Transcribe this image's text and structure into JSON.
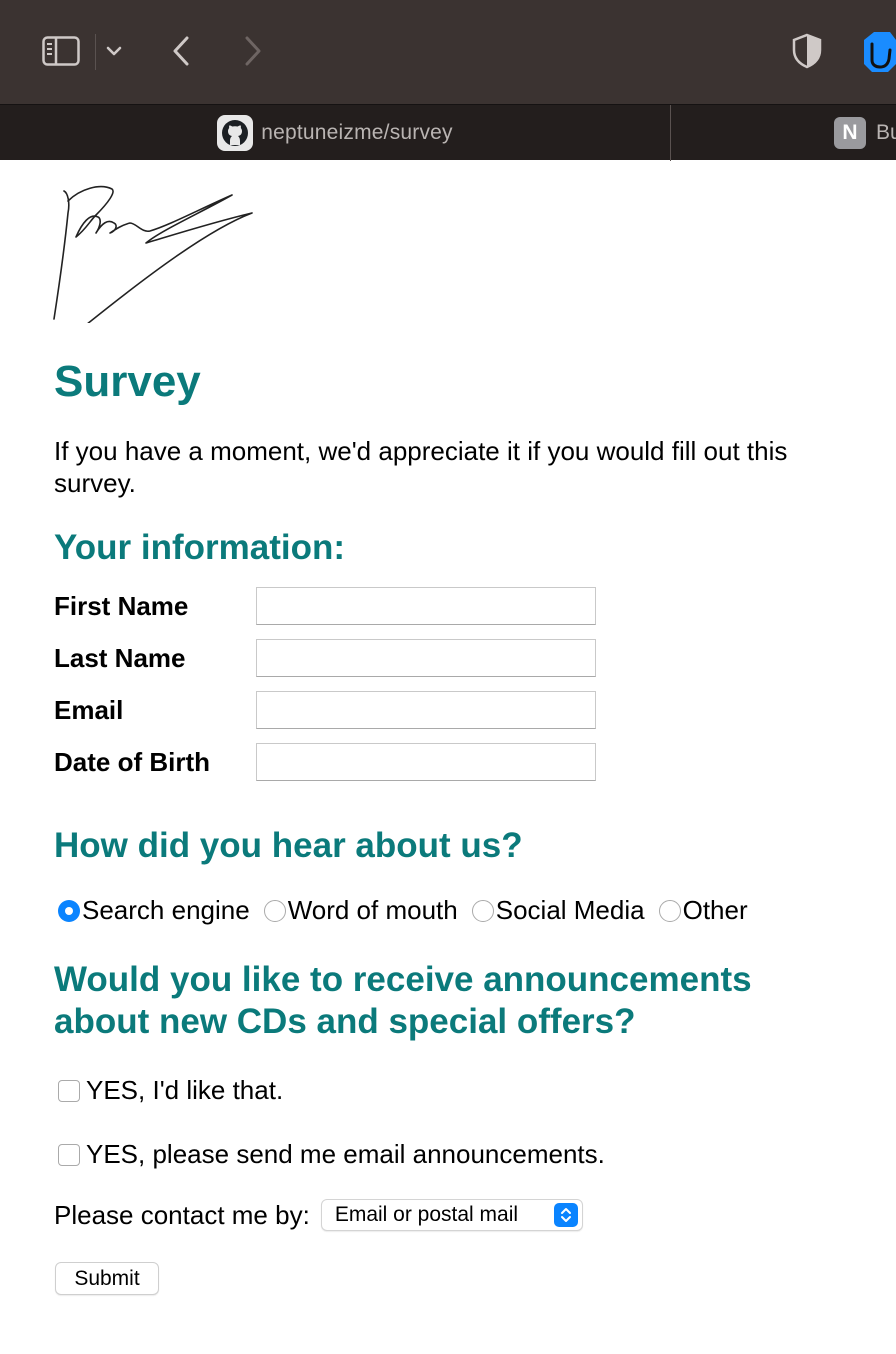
{
  "browser": {
    "active_tab_title": "neptuneizme/survey",
    "second_tab_letter": "N",
    "second_tab_title": "Bu"
  },
  "page": {
    "title": "Survey",
    "intro": "If you have a moment, we'd appreciate it if you would fill out this survey.",
    "info_heading": "Your information:",
    "fields": [
      {
        "label": "First Name",
        "value": ""
      },
      {
        "label": "Last Name",
        "value": ""
      },
      {
        "label": "Email",
        "value": ""
      },
      {
        "label": "Date of Birth",
        "value": ""
      }
    ],
    "hear_heading": "How did you hear about us?",
    "hear_options": [
      {
        "label": "Search engine",
        "checked": true
      },
      {
        "label": "Word of mouth",
        "checked": false
      },
      {
        "label": "Social Media",
        "checked": false
      },
      {
        "label": "Other",
        "checked": false
      }
    ],
    "announce_heading": "Would you like to receive announcements about new CDs and special offers?",
    "checkboxes": [
      {
        "label": "YES, I'd like that.",
        "checked": false
      },
      {
        "label": "YES, please send me email announcements.",
        "checked": false
      }
    ],
    "contact_label": "Please contact me by:",
    "contact_selected": "Email or postal mail",
    "submit_label": "Submit"
  },
  "colors": {
    "heading": "#0b7a7b",
    "toolbar": "#3b3331",
    "tabbar": "#231e1d",
    "accent": "#0a84ff"
  },
  "icons": [
    "sidebar-icon",
    "chevron-down-icon",
    "back-icon",
    "forward-icon",
    "shield-icon",
    "hand-blocker-icon",
    "github-icon",
    "signature-image"
  ]
}
